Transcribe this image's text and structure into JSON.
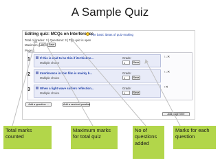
{
  "slide": {
    "title": "A Sample Quiz"
  },
  "quiz": {
    "editing_title": "Editing quiz: MCQs on Interference",
    "help_link": "The basic ideas of quiz-making",
    "total_line": "Total of grades: 3 | Questions: 3 | This quiz is open",
    "max_grade_label": "Maximum grade:",
    "max_grade_value": "100",
    "save_label": "Save",
    "page_label": "Page 1",
    "grade_label": "Grade:",
    "questions": [
      {
        "num": "1",
        "text": "If this is said to be thin if its thickne...",
        "type": "Multiple choice",
        "grade": "1",
        "controls": "↑↓✕"
      },
      {
        "num": "2",
        "text": "Interference in thin film is mainly b...",
        "type": "Multiple choice",
        "grade": "1",
        "controls": "↑↓✕"
      },
      {
        "num": "3",
        "text": "When a light wave suffers reflection...",
        "type": "Multiple choice",
        "grade": "1",
        "controls": "↑✕"
      }
    ],
    "add_question": "Add a question ...",
    "add_random": "Add a random question",
    "add_page": "Add page here"
  },
  "callouts": [
    {
      "text": "Total marks counted"
    },
    {
      "text": "Maximum marks for total quiz"
    },
    {
      "text": "No of questions added"
    },
    {
      "text": "Marks for each question"
    }
  ],
  "colors": {
    "callout_bg": "#b2d64a",
    "arrow": "#c0c0c0",
    "question_box": "#e8ebf8",
    "link": "#1f3fa8"
  }
}
